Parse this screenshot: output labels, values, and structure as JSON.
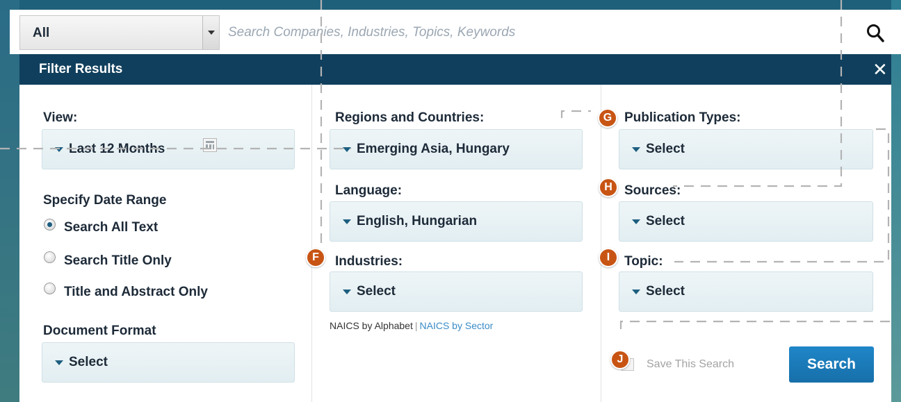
{
  "search": {
    "scope": "All",
    "placeholder": "Search Companies, Industries, Topics, Keywords"
  },
  "panel": {
    "title": "Filter Results",
    "close_glyph": "✕"
  },
  "view": {
    "label": "View:",
    "value": "Last 12 Months"
  },
  "date_range": {
    "label": "Specify Date Range",
    "options": [
      "Search All Text",
      "Search Title Only",
      "Title and Abstract Only"
    ],
    "selected": "Search All Text"
  },
  "document_format": {
    "label": "Document Format",
    "value": "Select"
  },
  "regions": {
    "label": "Regions and Countries:",
    "value": "Emerging Asia, Hungary"
  },
  "language": {
    "label": "Language:",
    "value": "English, Hungarian"
  },
  "industries": {
    "label": "Industries:",
    "value": "Select",
    "links": {
      "by_alphabet": "NAICS by Alphabet",
      "separator": "|",
      "by_sector": "NAICS by Sector"
    }
  },
  "publication_types": {
    "label": "Publication Types:",
    "value": "Select"
  },
  "sources": {
    "label": "Sources:",
    "value": "Select"
  },
  "topic": {
    "label": "Topic:",
    "value": "Select"
  },
  "actions": {
    "save_label": "Save This Search",
    "search_label": "Search"
  },
  "badges": {
    "f": "F",
    "g": "G",
    "h": "H",
    "i": "I",
    "j": "J",
    "color": "#c85414"
  },
  "colors": {
    "header": "#103f5d",
    "search_button": "#1f86c8",
    "select_bg": "#e8f2f5",
    "link": "#3a8cc7"
  }
}
